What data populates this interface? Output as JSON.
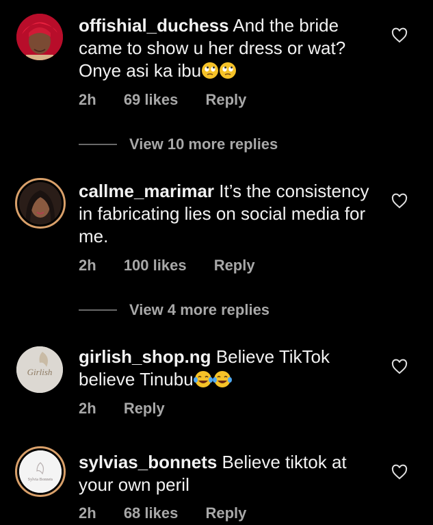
{
  "comments": [
    {
      "username": "offishial_duchess",
      "text": "And the bride came to show u her dress or wat? Onye asi ka ibu",
      "emojis": [
        "face-with-rolling-eyes",
        "face-with-rolling-eyes"
      ],
      "time": "2h",
      "likes": "69 likes",
      "reply": "Reply",
      "view_more": "View 10 more replies"
    },
    {
      "username": "callme_marimar",
      "text": "It’s the consistency in fabricating lies on social media for me.",
      "time": "2h",
      "likes": "100 likes",
      "reply": "Reply",
      "view_more": "View 4 more replies"
    },
    {
      "username": "girlish_shop.ng",
      "text": "Believe TikTok believe Tinubu",
      "emojis": [
        "face-with-tears-of-joy",
        "face-with-tears-of-joy"
      ],
      "time": "2h",
      "reply": "Reply"
    },
    {
      "username": "sylvias_bonnets",
      "text": "Believe tiktok at your own peril",
      "time": "2h",
      "likes": "68 likes",
      "reply": "Reply"
    }
  ],
  "avatar_texts": {
    "girlish": "Girlish",
    "sylvia": "Sylvia Bonnets"
  },
  "colors": {
    "background": "#000000",
    "text": "#f2f2f2",
    "meta": "#a8a8a8",
    "story_ring": "#d9a06a"
  }
}
